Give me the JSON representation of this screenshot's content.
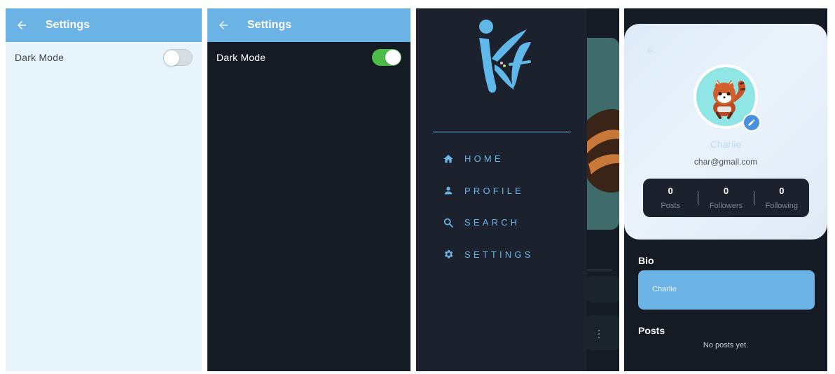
{
  "settings_light": {
    "title": "Settings",
    "dark_mode_label": "Dark Mode",
    "dark_mode_on": false
  },
  "settings_dark": {
    "title": "Settings",
    "dark_mode_label": "Dark Mode",
    "dark_mode_on": true
  },
  "drawer": {
    "logo_icon": "app-logo",
    "items": [
      {
        "label": "HOME",
        "icon": "home-icon"
      },
      {
        "label": "PROFILE",
        "icon": "person-icon"
      },
      {
        "label": "SEARCH",
        "icon": "search-icon"
      },
      {
        "label": "SETTINGS",
        "icon": "gear-icon"
      }
    ]
  },
  "profile": {
    "name": "Charlie",
    "email": "char@gmail.com",
    "stats": [
      {
        "value": "0",
        "label": "Posts"
      },
      {
        "value": "0",
        "label": "Followers"
      },
      {
        "value": "0",
        "label": "Following"
      }
    ],
    "bio_title": "Bio",
    "bio_text": "Charlie",
    "posts_title": "Posts",
    "posts_empty": "No posts yet."
  },
  "colors": {
    "primary": "#6bb3e4",
    "light_bg": "#e8f4fc",
    "dark_bg": "#141b24",
    "drawer_bg": "#1b222d",
    "toggle_on": "#4cbb4a",
    "edit_badge": "#4a8fe0"
  }
}
